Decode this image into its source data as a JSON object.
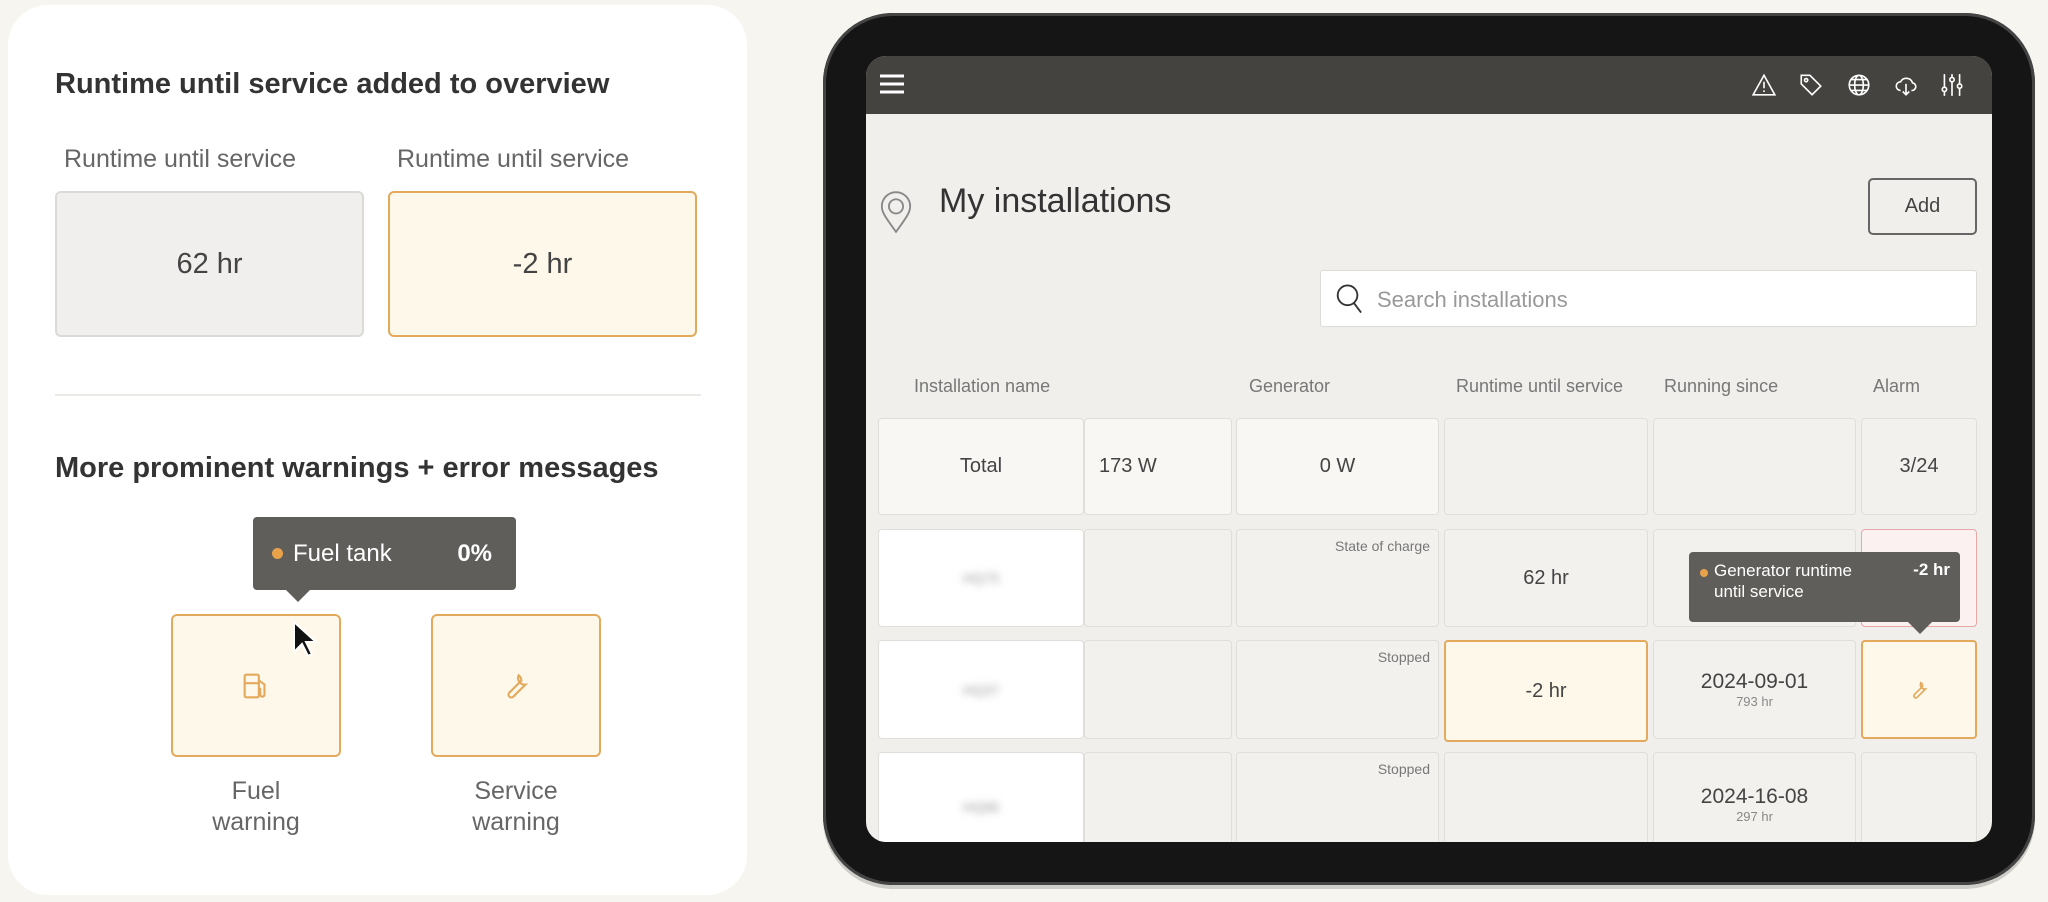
{
  "left_panel": {
    "section1_title": "Runtime until service added to overview",
    "cards": [
      {
        "label": "Runtime until service",
        "value": "62 hr"
      },
      {
        "label": "Runtime until service",
        "value": "-2 hr"
      }
    ],
    "section2_title": "More prominent warnings + error messages",
    "tooltip": {
      "label": "Fuel tank",
      "value": "0%"
    },
    "warnings": [
      {
        "label_line1": "Fuel",
        "label_line2": "warning",
        "icon": "fuel-pump-icon"
      },
      {
        "label_line1": "Service",
        "label_line2": "warning",
        "icon": "wrench-icon"
      }
    ]
  },
  "tablet": {
    "header_icons": [
      "menu-icon",
      "warning-icon",
      "tag-icon",
      "globe-icon",
      "cloud-download-icon",
      "sliders-icon"
    ],
    "title": "My installations",
    "add_label": "Add",
    "search_placeholder": "Search installations",
    "columns": [
      "Installation name",
      "Generator",
      "Runtime until service",
      "Running since",
      "Alarm"
    ],
    "total": {
      "name": "Total",
      "power": "173 W",
      "generator": "0 W",
      "alarm": "3/24"
    },
    "rows": [
      {
        "name": "HQ75",
        "generator_status": "State of charge",
        "runtime": "62 hr",
        "since": "",
        "since_hours": ""
      },
      {
        "name": "HQ37",
        "generator_status": "Stopped",
        "runtime": "-2 hr",
        "since": "2024-09-01",
        "since_hours": "793 hr"
      },
      {
        "name": "HQ86",
        "generator_status": "Stopped",
        "runtime": "",
        "since": "2024-16-08",
        "since_hours": "297 hr"
      }
    ],
    "tooltip": {
      "label": "Generator runtime until service",
      "value": "-2 hr"
    },
    "colors": {
      "warning": "#e3a95c",
      "header": "#45433f"
    }
  }
}
